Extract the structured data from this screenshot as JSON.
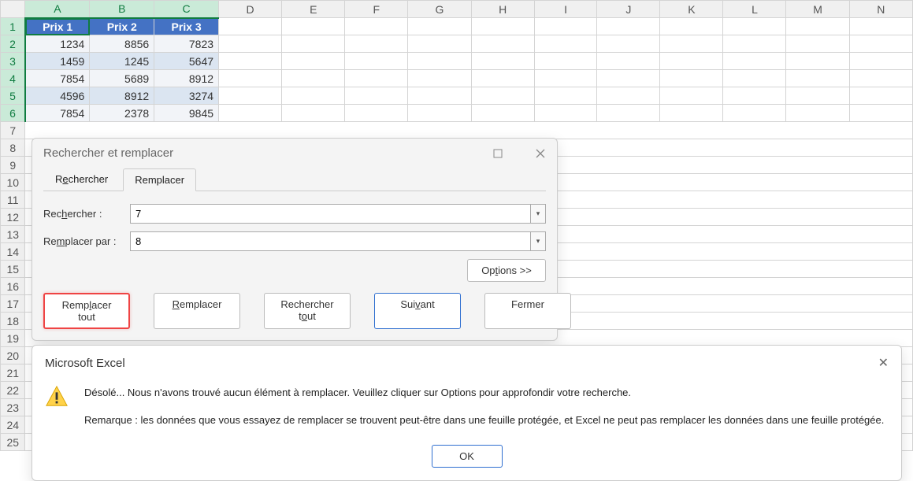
{
  "sheet": {
    "columns": [
      "A",
      "B",
      "C",
      "D",
      "E",
      "F",
      "G",
      "H",
      "I",
      "J",
      "K",
      "L",
      "M",
      "N"
    ],
    "selected_cols": [
      "A",
      "B",
      "C"
    ],
    "headers": [
      "Prix 1",
      "Prix 2",
      "Prix 3"
    ],
    "rows": [
      [
        "1234",
        "8856",
        "7823"
      ],
      [
        "1459",
        "1245",
        "5647"
      ],
      [
        "7854",
        "5689",
        "8912"
      ],
      [
        "4596",
        "8912",
        "3274"
      ],
      [
        "7854",
        "2378",
        "9845"
      ]
    ]
  },
  "findreplace": {
    "title": "Rechercher et remplacer",
    "tab_find": "Rechercher",
    "tab_replace": "Remplacer",
    "label_find": "Rechercher :",
    "label_replace": "Remplacer par :",
    "value_find": "7",
    "value_replace": "8",
    "btn_options": "Options >>",
    "btn_replace_all": "Remplacer tout",
    "btn_replace": "Remplacer",
    "btn_find_all": "Rechercher tout",
    "btn_next": "Suivant",
    "btn_close": "Fermer"
  },
  "msgbox": {
    "title": "Microsoft Excel",
    "line1": "Désolé... Nous n'avons trouvé aucun élément à remplacer. Veuillez cliquer sur Options pour approfondir votre recherche.",
    "line2": "Remarque : les données que vous essayez de remplacer se trouvent peut-être dans une feuille protégée, et Excel ne peut pas remplacer les données dans une feuille protégée.",
    "ok": "OK"
  }
}
